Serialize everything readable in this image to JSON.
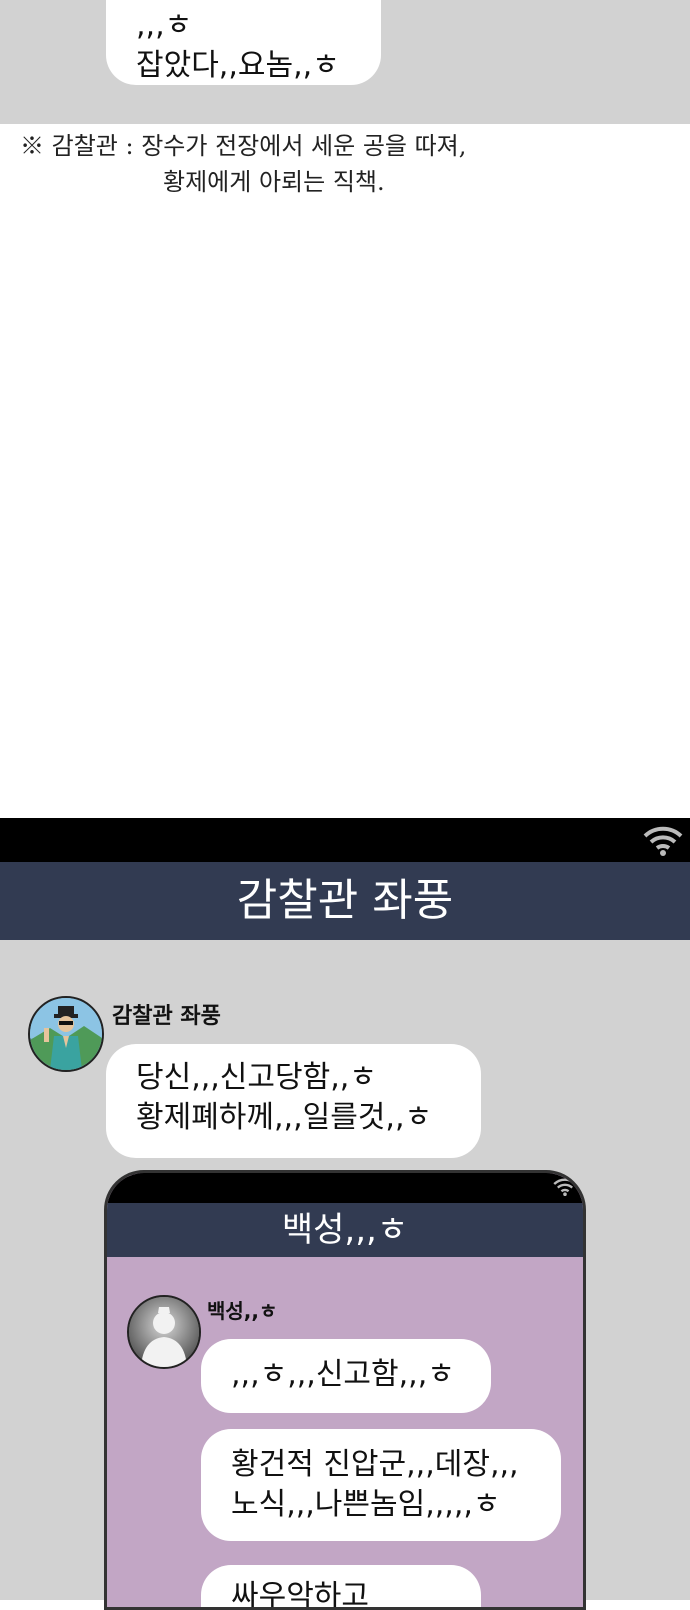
{
  "top_chat": {
    "bubble_lines": [
      ",,,ㅎ",
      "잡았다,,요놈,,ㅎ"
    ]
  },
  "footnote": {
    "line1": "※ 감찰관 : 장수가 전장에서 세운 공을 따져,",
    "line2": "황제에게 아뢰는 직책."
  },
  "chat": {
    "title": "감찰관 좌풍",
    "sender": "감찰관 좌풍",
    "message_lines": [
      "당신,,,신고당함,,ㅎ",
      "황제폐하께,,,일를것,,ㅎ"
    ]
  },
  "inner_chat": {
    "title": "백성,,,ㅎ",
    "sender": "백성,,ㅎ",
    "messages": [
      {
        "lines": [
          ",,,ㅎ,,,신고함,,,ㅎ"
        ]
      },
      {
        "lines": [
          "황건적 진압군,,,데장,,,",
          "노식,,,나쁜놈임,,,,,ㅎ"
        ]
      },
      {
        "lines": [
          "싸우악하고"
        ]
      }
    ]
  },
  "colors": {
    "header_bg": "#323b52",
    "chat_bg": "#d2d2d2",
    "inner_chat_bg": "#c2a6c5",
    "bubble_bg": "#ffffff"
  },
  "icons": [
    "wifi-icon",
    "avatar-official",
    "avatar-silhouette"
  ]
}
